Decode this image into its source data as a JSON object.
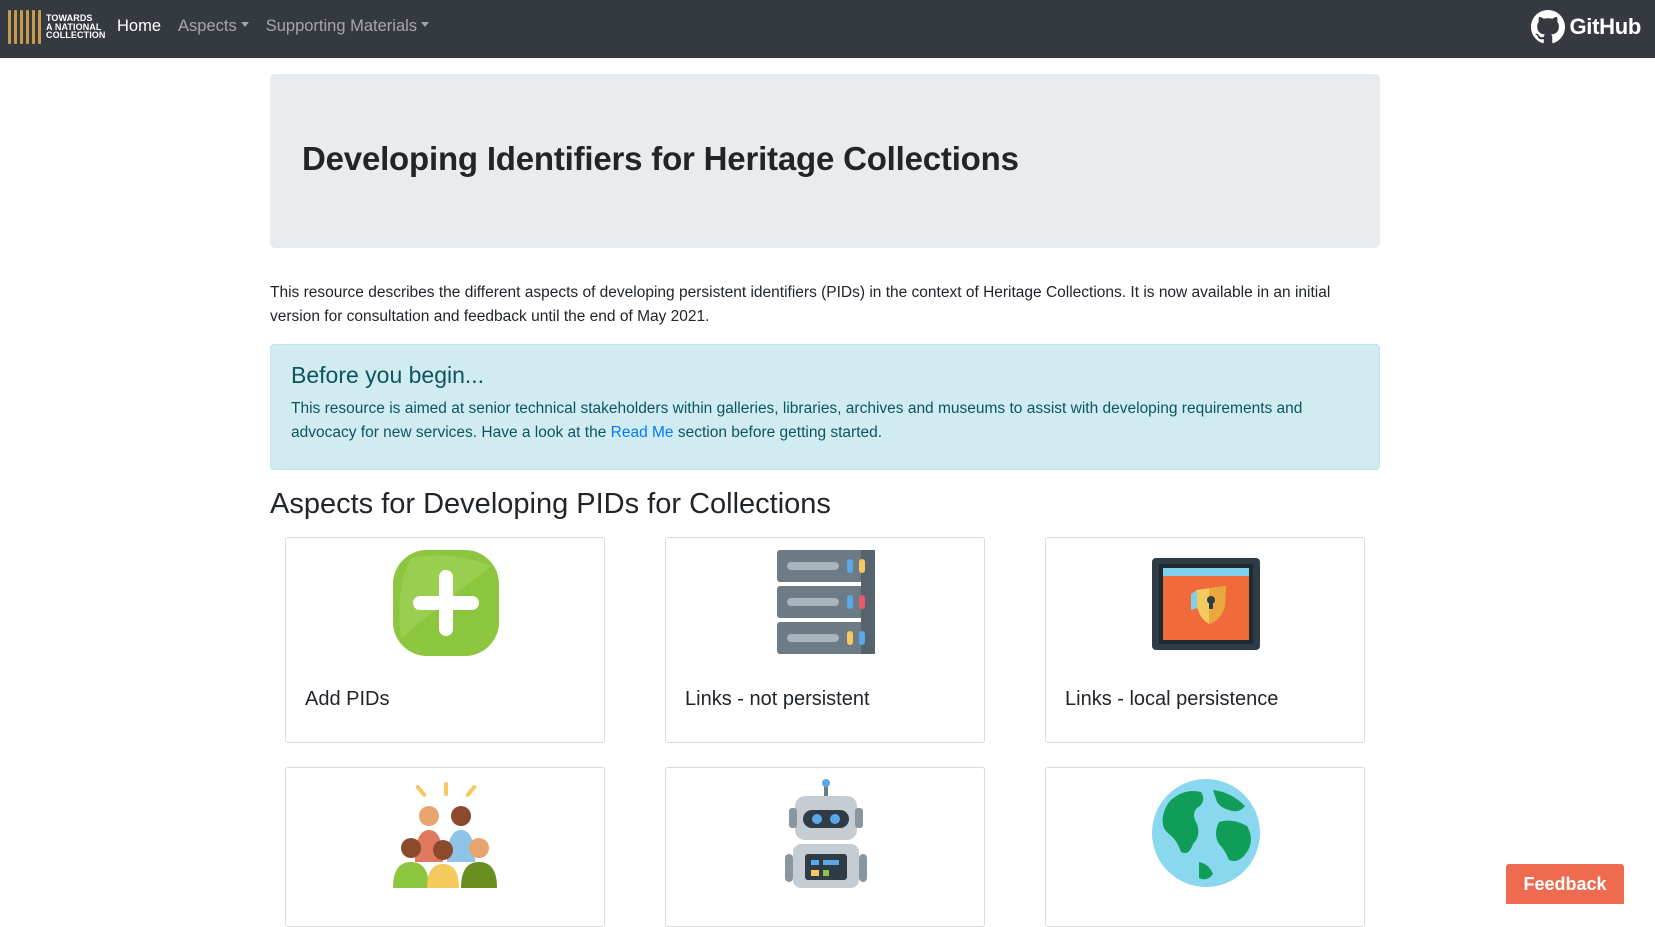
{
  "navbar": {
    "brand_lines": [
      "TOWARDS",
      "A NATIONAL",
      "COLLECTION"
    ],
    "links": [
      {
        "label": "Home",
        "active": true,
        "dropdown": false
      },
      {
        "label": "Aspects",
        "active": false,
        "dropdown": true
      },
      {
        "label": "Supporting Materials",
        "active": false,
        "dropdown": true
      }
    ],
    "github_label": "GitHub"
  },
  "jumbotron": {
    "title": "Developing Identifiers for Heritage Collections"
  },
  "intro": "This resource describes the different aspects of developing persistent identifiers (PIDs) in the context of Heritage Collections. It is now available in an initial version for consultation and feedback until the end of May 2021.",
  "alert": {
    "heading": "Before you begin...",
    "text_before": "This resource is aimed at senior technical stakeholders within galleries, libraries, archives and museums to assist with developing requirements and advocacy for new services. Have a look at the ",
    "link": "Read Me",
    "text_after": " section before getting started."
  },
  "section_title": "Aspects for Developing PIDs for Collections",
  "cards": [
    {
      "label": "Add PIDs",
      "icon": "add-icon"
    },
    {
      "label": "Links - not persistent",
      "icon": "server-icon"
    },
    {
      "label": "Links - local persistence",
      "icon": "safe-icon"
    },
    {
      "label": "",
      "icon": "people-icon"
    },
    {
      "label": "",
      "icon": "robot-icon"
    },
    {
      "label": "",
      "icon": "globe-icon"
    }
  ],
  "feedback_label": "Feedback",
  "colors": {
    "navbar": "#343a40",
    "jumbotron": "#e9ecef",
    "alert_bg": "#d1ecf1",
    "alert_text": "#0c5460",
    "link": "#007bff",
    "feedback": "#ef6b4f"
  }
}
